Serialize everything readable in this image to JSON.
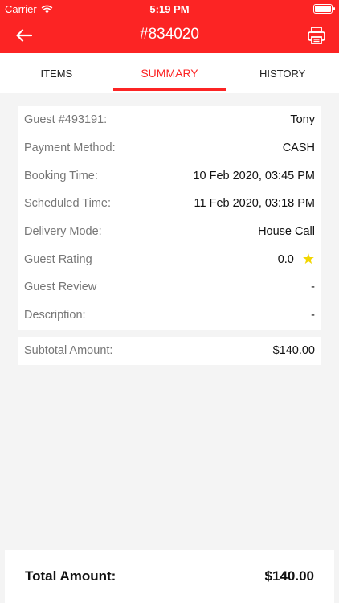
{
  "status_bar": {
    "carrier": "Carrier",
    "time": "5:19 PM"
  },
  "nav": {
    "title": "#834020",
    "back_icon": "back-arrow-icon",
    "print_icon": "printer-icon"
  },
  "tabs": [
    {
      "label": "ITEMS",
      "active": false
    },
    {
      "label": "SUMMARY",
      "active": true
    },
    {
      "label": "HISTORY",
      "active": false
    }
  ],
  "details": [
    {
      "label": "Guest #493191:",
      "value": "Tony"
    },
    {
      "label": "Payment Method:",
      "value": "CASH"
    },
    {
      "label": "Booking Time:",
      "value": "10 Feb 2020, 03:45 PM"
    },
    {
      "label": "Scheduled Time:",
      "value": "11 Feb 2020, 03:18 PM"
    },
    {
      "label": "Delivery Mode:",
      "value": "House Call"
    },
    {
      "label": "Guest Rating",
      "value": "0.0",
      "icon": "star-icon"
    },
    {
      "label": "Guest Review",
      "value": "-"
    },
    {
      "label": "Description:",
      "value": "-"
    }
  ],
  "subtotal": {
    "label": "Subtotal Amount:",
    "value": "$140.00"
  },
  "total": {
    "label": "Total Amount:",
    "value": "$140.00"
  },
  "colors": {
    "accent": "#fc2424",
    "background": "#f4f4f4",
    "star": "#f2d600"
  }
}
